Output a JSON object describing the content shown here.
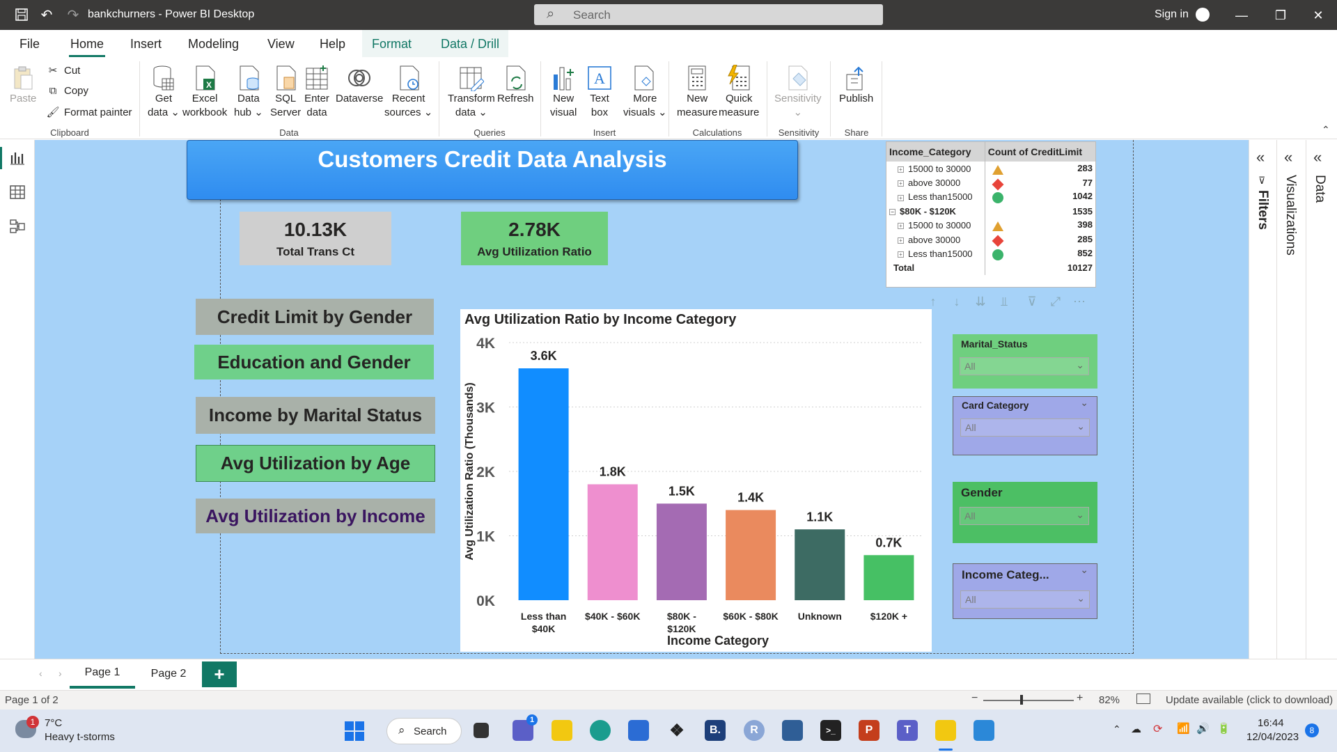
{
  "window": {
    "title": "bankchurners - Power BI Desktop",
    "search_placeholder": "Search",
    "sign_in": "Sign in"
  },
  "ribbon_tabs": [
    "File",
    "Home",
    "Insert",
    "Modeling",
    "View",
    "Help",
    "Format",
    "Data / Drill"
  ],
  "ribbon": {
    "clipboard": {
      "paste": "Paste",
      "cut": "Cut",
      "copy": "Copy",
      "format_painter": "Format painter",
      "group": "Clipboard"
    },
    "data": {
      "get_data": "Get data",
      "excel": "Excel workbook",
      "data_hub": "Data hub",
      "sql": "SQL Server",
      "enter_data": "Enter data",
      "dataverse": "Dataverse",
      "recent": "Recent sources",
      "group": "Data"
    },
    "queries": {
      "transform": "Transform data",
      "refresh": "Refresh",
      "group": "Queries"
    },
    "insert": {
      "new_visual": "New visual",
      "text_box": "Text box",
      "more_visuals": "More visuals",
      "group": "Insert"
    },
    "calculations": {
      "new_measure": "New measure",
      "quick_measure": "Quick measure",
      "group": "Calculations"
    },
    "sensitivity": {
      "label": "Sensitivity",
      "group": "Sensitivity"
    },
    "share": {
      "publish": "Publish",
      "group": "Share"
    }
  },
  "report": {
    "banner": "Customers Credit Data Analysis",
    "kpis": [
      {
        "value": "10.13K",
        "label": "Total Trans Ct",
        "bg": "#cfcfcf"
      },
      {
        "value": "2.78K",
        "label": "Avg Utilization Ratio",
        "bg": "#6fcf7f"
      }
    ],
    "nav_buttons": [
      {
        "label": "Credit Limit by Gender",
        "bg": "#a9b1a9",
        "color": "#252423"
      },
      {
        "label": "Education and Gender",
        "bg": "#6fd08a",
        "color": "#252423"
      },
      {
        "label": "Income by Marital Status",
        "bg": "#a9b1a9",
        "color": "#252423"
      },
      {
        "label": "Avg Utilization by Age",
        "bg": "#6fd08a",
        "color": "#252423"
      },
      {
        "label": "Avg Utilization by Income",
        "bg": "#a9b1a9",
        "color": "#3a1560"
      }
    ],
    "matrix": {
      "headers": [
        "Income_Category",
        "Count of CreditLimit"
      ],
      "rows": [
        {
          "label": "15000 to 30000",
          "value": "283",
          "kpi": "triangle",
          "level": 1
        },
        {
          "label": "above 30000",
          "value": "77",
          "kpi": "diamond",
          "level": 1
        },
        {
          "label": "Less than15000",
          "value": "1042",
          "kpi": "circle",
          "level": 1
        },
        {
          "label": "$80K - $120K",
          "value": "1535",
          "kpi": "",
          "level": 0
        },
        {
          "label": "15000 to 30000",
          "value": "398",
          "kpi": "triangle",
          "level": 1
        },
        {
          "label": "above 30000",
          "value": "285",
          "kpi": "diamond",
          "level": 1
        },
        {
          "label": "Less than15000",
          "value": "852",
          "kpi": "circle",
          "level": 1
        }
      ],
      "total_label": "Total",
      "total_value": "10127"
    },
    "slicers": [
      {
        "title": "Marital_Status",
        "value": "All",
        "bg": "#6fcf7f"
      },
      {
        "title": "Card Category",
        "value": "All",
        "bg": "#9fa8e8"
      },
      {
        "title": "Gender",
        "value": "All",
        "bg": "#4cbf64"
      },
      {
        "title": "Income Categ...",
        "value": "All",
        "bg": "#9fa8e8"
      }
    ]
  },
  "chart_data": {
    "type": "bar",
    "title": "Avg Utilization Ratio by Income Category",
    "xlabel": "Income Category",
    "ylabel": "Avg Utilization Ratio (Thousands)",
    "categories": [
      "Less than $40K",
      "$40K - $60K",
      "$80K - $120K",
      "$60K - $80K",
      "Unknown",
      "$120K +"
    ],
    "values": [
      3.6,
      1.8,
      1.5,
      1.4,
      1.1,
      0.7
    ],
    "data_labels": [
      "3.6K",
      "1.8K",
      "1.5K",
      "1.4K",
      "1.1K",
      "0.7K"
    ],
    "colors": [
      "#118dff",
      "#ee8fcf",
      "#a46bb3",
      "#ea8a5e",
      "#3d6b63",
      "#46c064"
    ],
    "ylim": [
      0,
      4
    ],
    "yticks": [
      "0K",
      "1K",
      "2K",
      "3K",
      "4K"
    ],
    "grid": true
  },
  "panes": {
    "filters": "Filters",
    "visualizations": "Visualizations",
    "data": "Data"
  },
  "pages": {
    "tabs": [
      "Page 1",
      "Page 2"
    ],
    "active": "Page 1",
    "add": "+"
  },
  "status": {
    "page_info": "Page 1 of 2",
    "zoom": "82%",
    "update": "Update available (click to download)"
  },
  "taskbar": {
    "weather_temp": "7°C",
    "weather_desc": "Heavy t-storms",
    "weather_badge": "1",
    "search": "Search",
    "time": "16:44",
    "date": "12/04/2023",
    "notif_count": "8",
    "chat_badge": "1"
  }
}
